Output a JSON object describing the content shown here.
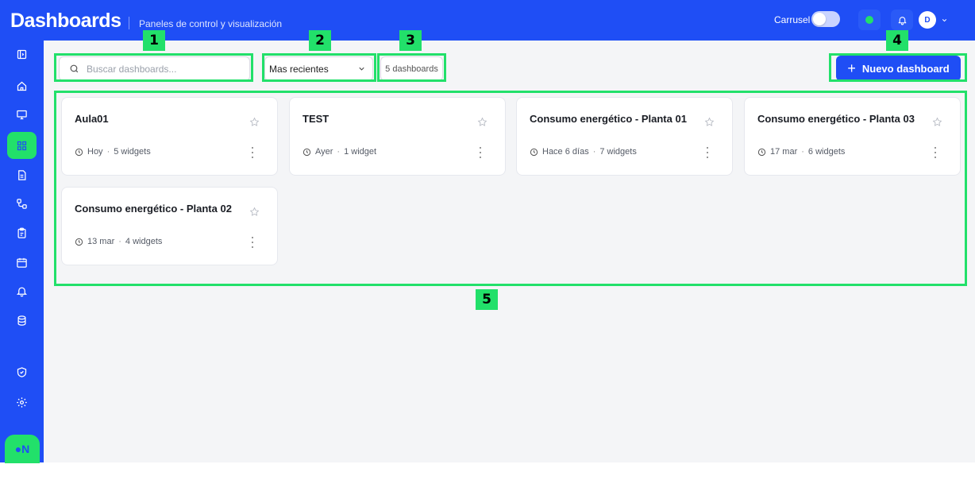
{
  "header": {
    "title": "Dashboards",
    "subtitle": "Paneles de control y visualización",
    "carrusel_label": "Carrusel",
    "user_initial": "D"
  },
  "toolbar": {
    "search_placeholder": "Buscar dashboards...",
    "sort_value": "Mas recientes",
    "count_label": "5 dashboards",
    "new_button_label": "Nuevo dashboard"
  },
  "dashboards": [
    {
      "title": "Aula01",
      "updated": "Hoy",
      "widgets": "5 widgets"
    },
    {
      "title": "TEST",
      "updated": "Ayer",
      "widgets": "1 widget"
    },
    {
      "title": "Consumo energético - Planta 01",
      "updated": "Hace 6 días",
      "widgets": "7 widgets"
    },
    {
      "title": "Consumo energético - Planta 03",
      "updated": "17 mar",
      "widgets": "6 widgets"
    },
    {
      "title": "Consumo energético - Planta 02",
      "updated": "13 mar",
      "widgets": "4 widgets"
    }
  ],
  "sidebar": {
    "items": [
      "expand-icon",
      "home-icon",
      "monitor-icon",
      "dashboard-grid-icon",
      "document-icon",
      "workflow-icon",
      "clipboard-icon",
      "calendar-icon",
      "bell-icon",
      "database-icon",
      "shield-icon",
      "gear-icon"
    ],
    "logo_text": "●N"
  },
  "annotations": [
    "1",
    "2",
    "3",
    "4",
    "5"
  ],
  "colors": {
    "primary": "#1f4ef5",
    "accent": "#22e06a",
    "background": "#f4f5f7"
  }
}
